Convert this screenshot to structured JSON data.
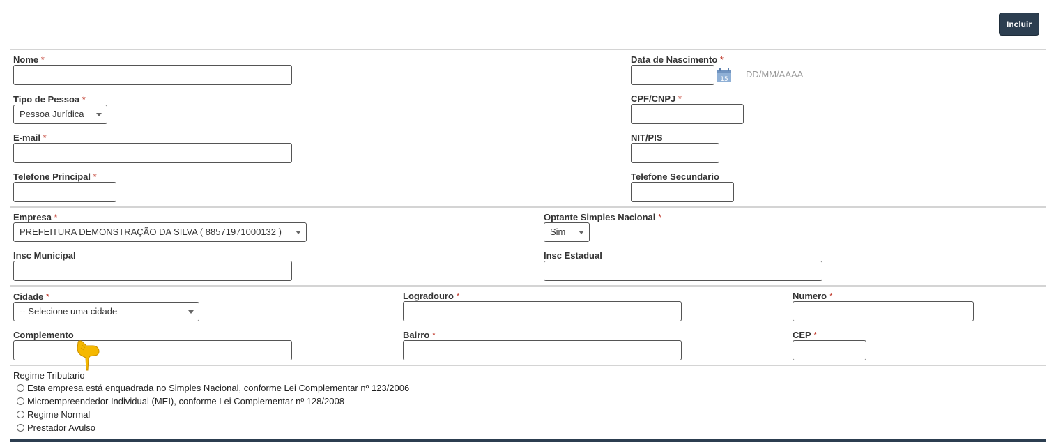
{
  "actions": {
    "incluir_label": "Incluir"
  },
  "required_mark": "*",
  "personal": {
    "nome_label": "Nome",
    "data_nascimento_label": "Data de Nascimento",
    "data_nascimento_placeholder": "DD/MM/AAAA",
    "tipo_pessoa_label": "Tipo de Pessoa",
    "tipo_pessoa_value": "Pessoa Jurídica",
    "cpf_cnpj_label": "CPF/CNPJ",
    "email_label": "E-mail",
    "nit_pis_label": "NIT/PIS",
    "telefone_principal_label": "Telefone Principal",
    "telefone_secundario_label": "Telefone Secundario"
  },
  "company": {
    "empresa_label": "Empresa",
    "empresa_value": "PREFEITURA DEMONSTRAÇÃO DA SILVA ( 88571971000132 )",
    "optante_label": "Optante Simples Nacional",
    "optante_value": "Sim",
    "insc_municipal_label": "Insc Municipal",
    "insc_estadual_label": "Insc Estadual"
  },
  "address": {
    "cidade_label": "Cidade",
    "cidade_value": "-- Selecione uma cidade",
    "logradouro_label": "Logradouro",
    "numero_label": "Numero",
    "complemento_label": "Complemento",
    "bairro_label": "Bairro",
    "cep_label": "CEP"
  },
  "regime": {
    "label": "Regime Tributario",
    "options": [
      "Esta empresa está enquadrada no Simples Nacional, conforme Lei Complementar nº 123/2006",
      "Microempreendedor Individual (MEI), conforme Lei Complementar nº 128/2008",
      "Regime Normal",
      "Prestador Avulso"
    ]
  },
  "icons": {
    "calendar": "calendar-icon",
    "cursor": "pointing-hand-icon"
  },
  "colors": {
    "primary": "#2c3e50",
    "required": "#c0392b",
    "calendar": "#8fb0d6",
    "cursor": "#f5b800"
  }
}
